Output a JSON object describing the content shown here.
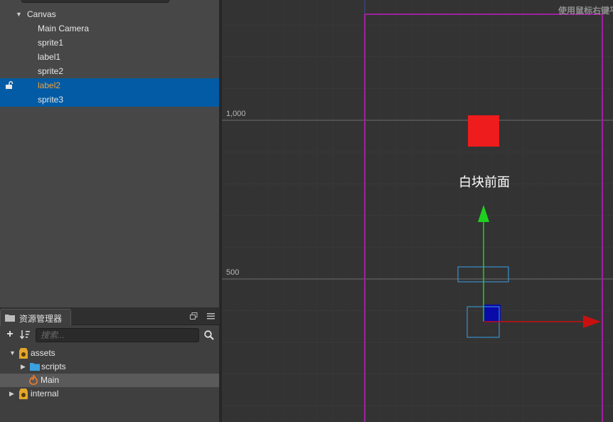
{
  "hierarchy": {
    "items": [
      {
        "label": "Canvas",
        "expanded": true,
        "selected": false,
        "locked": false
      },
      {
        "label": "Main Camera",
        "selected": false,
        "locked": false
      },
      {
        "label": "sprite1",
        "selected": false,
        "locked": false
      },
      {
        "label": "label1",
        "selected": false,
        "locked": false
      },
      {
        "label": "sprite2",
        "selected": false,
        "locked": false
      },
      {
        "label": "label2",
        "selected": true,
        "locked": true,
        "label_color": "#f2a23a"
      },
      {
        "label": "sprite3",
        "selected": true,
        "locked": false
      }
    ]
  },
  "assets": {
    "tab_label": "资源管理器",
    "search_placeholder": "搜索...",
    "items": [
      {
        "label": "assets",
        "icon": "asset-db-icon",
        "expanded": true
      },
      {
        "label": "scripts",
        "icon": "folder-icon",
        "expanded": false
      },
      {
        "label": "Main",
        "icon": "fire-scene-icon",
        "highlight": true
      },
      {
        "label": "internal",
        "icon": "asset-db-icon",
        "expanded": false
      }
    ]
  },
  "scene": {
    "hint_text": "使用鼠标右键平",
    "axis_labels": [
      "1,000",
      "500"
    ],
    "label2_text": "白块前面",
    "colors": {
      "canvas_border": "#a020a0",
      "red_sprite": "#ee1c1c",
      "blue_sprite": "#0a0aa8",
      "gizmo_y": "#1fd11f",
      "gizmo_x": "#c81010",
      "selection_box": "#3aa0e8"
    }
  },
  "colors": {
    "selection": "#025ba4",
    "panel_bg": "#474747"
  }
}
